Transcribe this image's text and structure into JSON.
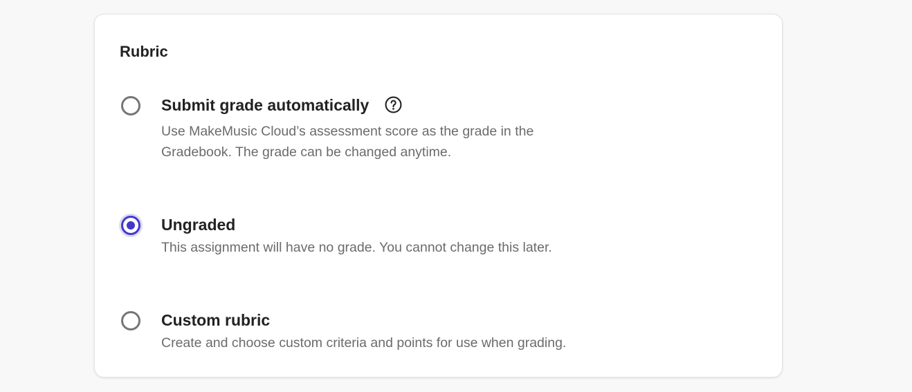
{
  "rubric": {
    "title": "Rubric",
    "options": [
      {
        "label": "Submit grade automatically",
        "description": "Use MakeMusic Cloud’s assessment score as the grade in the Gradebook. The grade can be changed anytime.",
        "selected": false,
        "has_help_icon": true
      },
      {
        "label": "Ungraded",
        "description": "This assignment will have no grade. You cannot change this later.",
        "selected": true,
        "has_help_icon": false
      },
      {
        "label": "Custom rubric",
        "description": "Create and choose custom criteria and points for use when grading.",
        "selected": false,
        "has_help_icon": false
      }
    ]
  },
  "icons": {
    "help": "question-circle"
  },
  "colors": {
    "accent": "#4338ca",
    "radio_border": "#757575",
    "label": "#222222",
    "description": "#6b6b6b",
    "card_background": "#ffffff",
    "page_background": "#f8f8f8"
  }
}
